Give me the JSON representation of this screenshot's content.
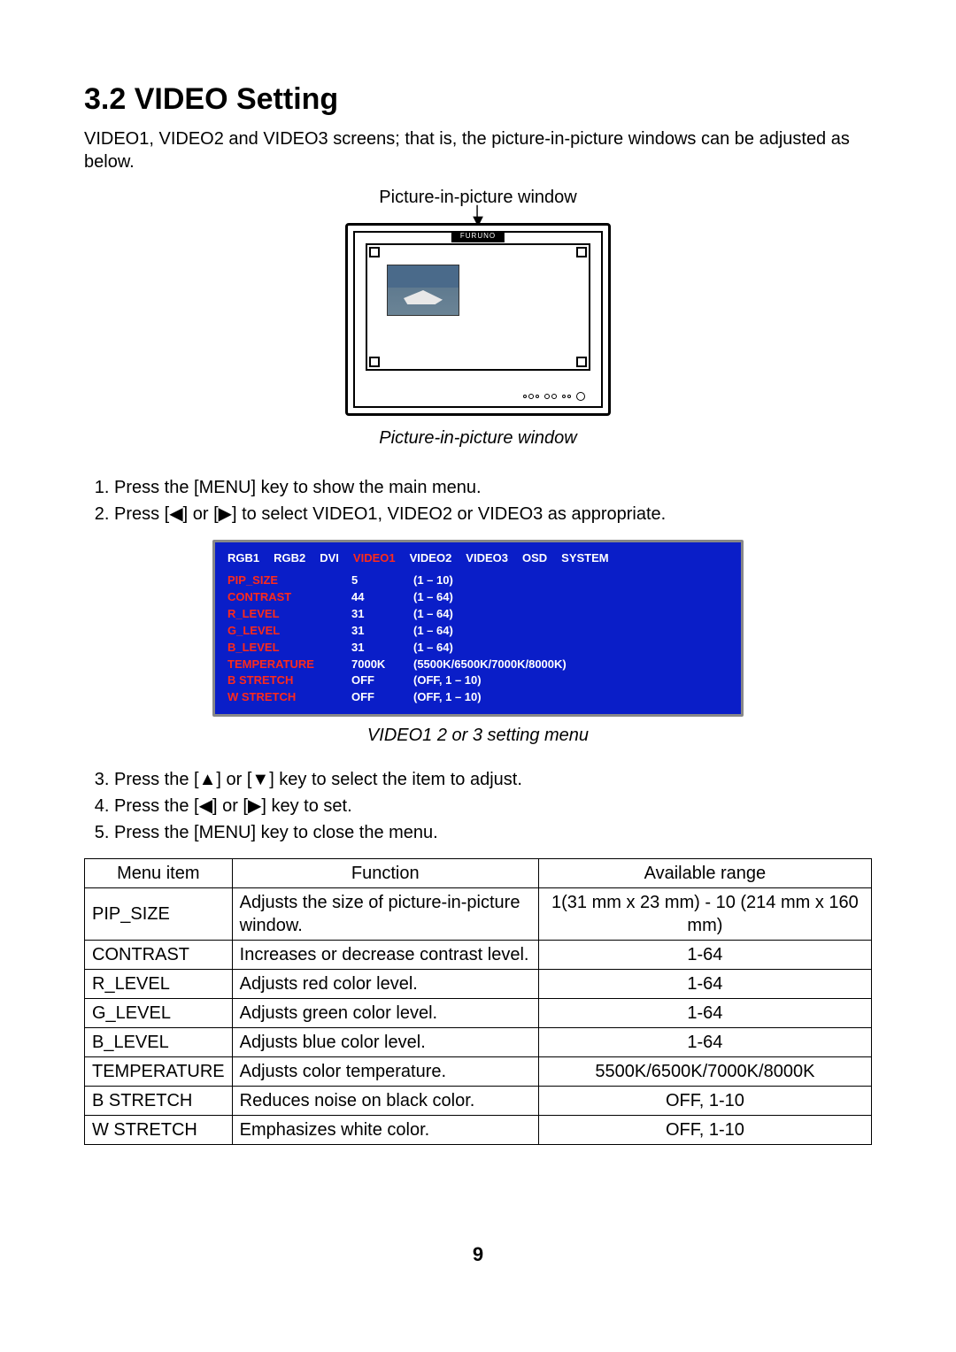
{
  "section": {
    "heading": "3.2 VIDEO Setting",
    "intro": "VIDEO1, VIDEO2 and VIDEO3 screens; that is, the picture-in-picture windows can be adjusted as below.",
    "pip_top_label": "Picture-in-picture window",
    "pip_caption": "Picture-in-picture window",
    "brand": "FURUNO"
  },
  "steps_a": [
    "Press the [MENU] key to show the main menu.",
    "Press [◀] or [▶] to select VIDEO1, VIDEO2 or VIDEO3 as appropriate."
  ],
  "osd": {
    "tabs": [
      "RGB1",
      "RGB2",
      "DVI",
      "VIDEO1",
      "VIDEO2",
      "VIDEO3",
      "OSD",
      "SYSTEM"
    ],
    "active_index": 3,
    "items": [
      {
        "name": "PIP_SIZE",
        "value": "5",
        "range": "(1 – 10)"
      },
      {
        "name": "CONTRAST",
        "value": "44",
        "range": "(1 – 64)"
      },
      {
        "name": "R_LEVEL",
        "value": "31",
        "range": "(1 – 64)"
      },
      {
        "name": "G_LEVEL",
        "value": "31",
        "range": "(1 – 64)"
      },
      {
        "name": "B_LEVEL",
        "value": "31",
        "range": "(1 – 64)"
      },
      {
        "name": "TEMPERATURE",
        "value": "7000K",
        "range": "(5500K/6500K/7000K/8000K)"
      },
      {
        "name": "B STRETCH",
        "value": "OFF",
        "range": "(OFF, 1 – 10)"
      },
      {
        "name": "W STRETCH",
        "value": "OFF",
        "range": "(OFF, 1 – 10)"
      }
    ],
    "caption": "VIDEO1 2 or 3 setting menu"
  },
  "steps_b_start": 3,
  "steps_b": [
    "Press the [▲] or [▼] key to select the item to adjust.",
    "Press the [◀] or [▶] key to set.",
    "Press the [MENU] key to close the menu."
  ],
  "table": {
    "headers": [
      "Menu item",
      "Function",
      "Available range"
    ],
    "rows": [
      {
        "item": "PIP_SIZE",
        "func": "Adjusts the size of picture-in-picture window.",
        "range": "1(31 mm x 23 mm) - 10 (214 mm x 160 mm)"
      },
      {
        "item": "CONTRAST",
        "func": "Increases or decrease contrast level.",
        "range": "1-64"
      },
      {
        "item": "R_LEVEL",
        "func": "Adjusts red color level.",
        "range": "1-64"
      },
      {
        "item": "G_LEVEL",
        "func": "Adjusts green color level.",
        "range": "1-64"
      },
      {
        "item": "B_LEVEL",
        "func": "Adjusts blue color level.",
        "range": "1-64"
      },
      {
        "item": "TEMPERATURE",
        "func": "Adjusts color temperature.",
        "range": "5500K/6500K/7000K/8000K"
      },
      {
        "item": "B STRETCH",
        "func": "Reduces noise on black color.",
        "range": "OFF, 1-10"
      },
      {
        "item": "W STRETCH",
        "func": "Emphasizes white color.",
        "range": "OFF, 1-10"
      }
    ]
  },
  "page_number": "9"
}
